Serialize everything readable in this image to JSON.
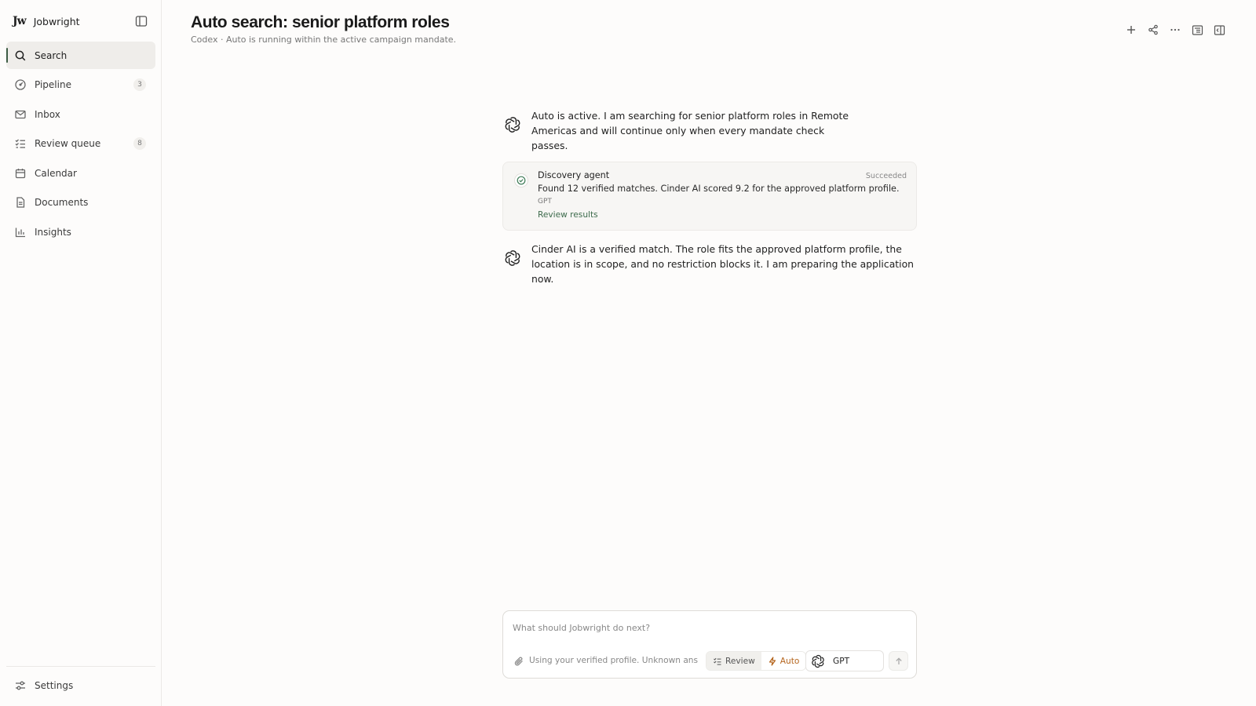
{
  "app": {
    "logo_text": "Jw",
    "name": "Jobwright"
  },
  "sidebar": {
    "items": [
      {
        "label": "Search",
        "icon": "search-icon",
        "active": true
      },
      {
        "label": "Pipeline",
        "icon": "gauge-icon",
        "count": "3"
      },
      {
        "label": "Inbox",
        "icon": "mail-icon"
      },
      {
        "label": "Review queue",
        "icon": "list-check-icon",
        "count": "8"
      },
      {
        "label": "Calendar",
        "icon": "calendar-icon"
      },
      {
        "label": "Documents",
        "icon": "document-icon"
      },
      {
        "label": "Insights",
        "icon": "bar-chart-icon"
      }
    ],
    "settings_label": "Settings"
  },
  "header": {
    "title": "Auto search: senior platform roles",
    "subtitle": "Codex · Auto is running within the active campaign mandate."
  },
  "conversation": {
    "message1": "Auto is active. I am searching for senior platform roles in Remote Americas and will continue only when every mandate check passes.",
    "agent_card": {
      "name": "Discovery agent",
      "status": "Succeeded",
      "description": "Found 12 verified matches. Cinder AI scored 9.2 for the approved platform profile.",
      "model": "GPT",
      "link": "Review results"
    },
    "message2": "Cinder AI is a verified match. The role fits the approved platform profile, the location is in scope, and no restriction blocks it. I am preparing the application now."
  },
  "composer": {
    "placeholder": "What should Jobwright do next?",
    "profile_note": "Using your verified profile. Unknown ans",
    "mode_review": "Review",
    "mode_auto": "Auto",
    "model": "GPT"
  },
  "colors": {
    "accent_green": "#3d5c44",
    "auto_orange": "#b5651d",
    "link_green": "#3d6b4c"
  }
}
